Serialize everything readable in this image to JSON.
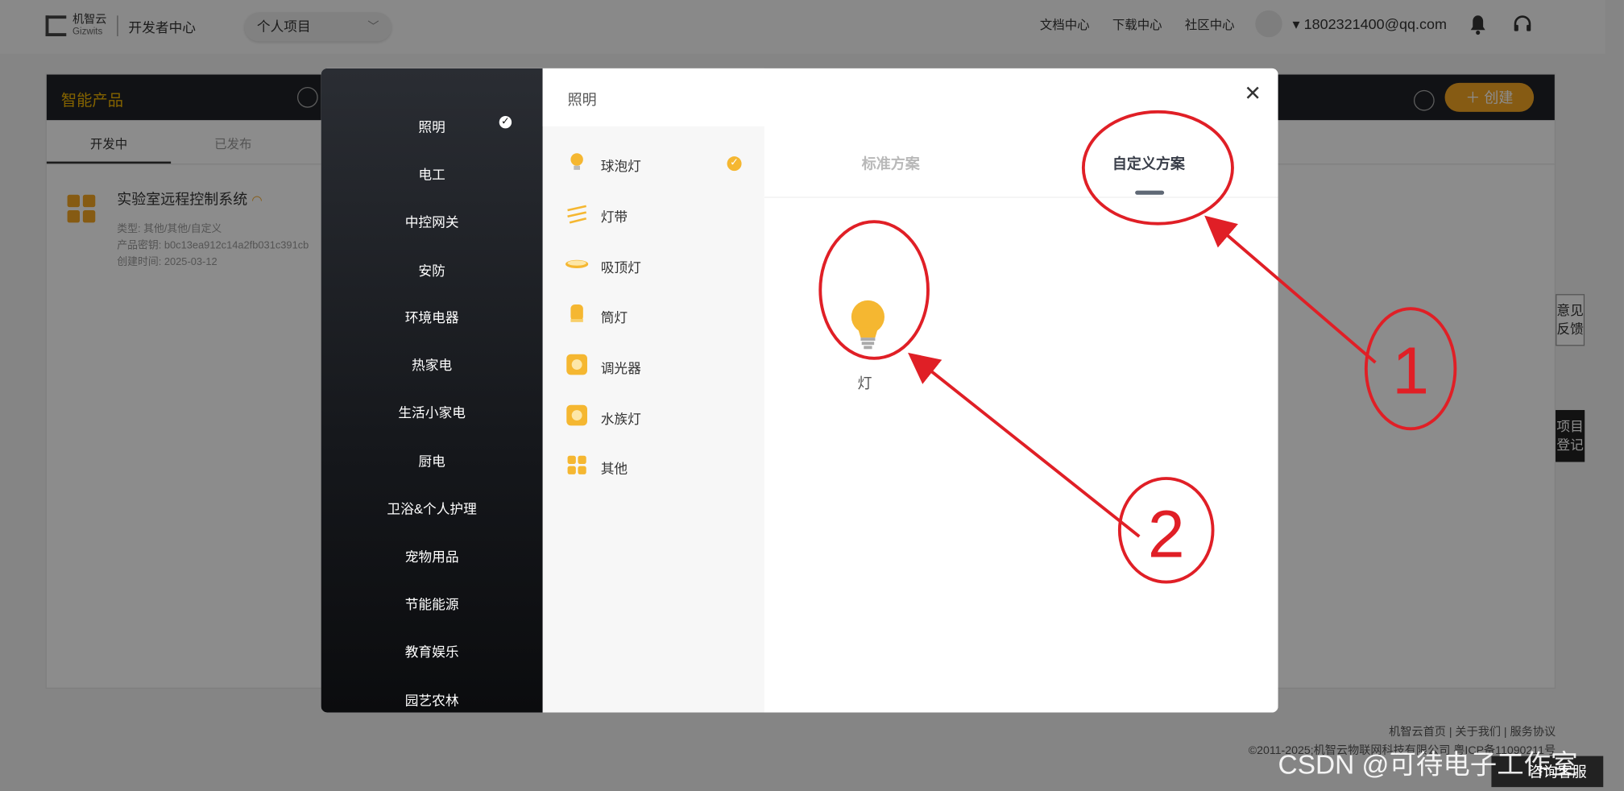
{
  "topbar": {
    "logo_cn": "机智云",
    "logo_en": "Gizwits",
    "dev_center": "开发者中心",
    "project_select": "个人项目",
    "nav_links": [
      "文档中心",
      "下载中心",
      "社区中心"
    ],
    "user_email": "▾ 1802321400@qq.com"
  },
  "page": {
    "section_title": "智能产品",
    "create_label": "＋ 创建",
    "tabs": [
      "开发中",
      "已发布"
    ],
    "product": {
      "name": "实验室远程控制系统",
      "type": "类型: 其他/其他/自定义",
      "key": "产品密钥: b0c13ea912c14a2fb031c391cb",
      "created": "创建时间: 2025-03-12"
    }
  },
  "footer": {
    "links": "机智云首页 | 关于我们 | 服务协议",
    "copyright": "©2011-2025;机智云物联网科技有限公司 粤ICP备11090211号"
  },
  "side_tags": [
    "意见反馈",
    "项目登记"
  ],
  "consult_label": "咨询客服",
  "watermark": "CSDN @可待电子工作室",
  "modal": {
    "title": "照明",
    "categories": [
      "照明",
      "电工",
      "中控网关",
      "安防",
      "环境电器",
      "热家电",
      "生活小家电",
      "厨电",
      "卫浴&个人护理",
      "宠物用品",
      "节能能源",
      "教育娱乐",
      "园艺农林"
    ],
    "selected_category": "照明",
    "sub_categories": [
      {
        "label": "球泡灯",
        "icon": "bulb-icon"
      },
      {
        "label": "灯带",
        "icon": "strip-light-icon"
      },
      {
        "label": "吸顶灯",
        "icon": "ceiling-light-icon"
      },
      {
        "label": "筒灯",
        "icon": "downlight-icon"
      },
      {
        "label": "调光器",
        "icon": "dimmer-icon"
      },
      {
        "label": "水族灯",
        "icon": "aquarium-light-icon"
      },
      {
        "label": "其他",
        "icon": "other-grid-icon"
      }
    ],
    "selected_sub": "球泡灯",
    "scheme_tabs": [
      "标准方案",
      "自定义方案"
    ],
    "active_scheme": "自定义方案",
    "devices": [
      {
        "label": "灯",
        "icon": "bulb-icon"
      }
    ]
  },
  "annotations": {
    "mark1": "1",
    "mark2": "2",
    "color": "#e01f26"
  },
  "colors": {
    "accent": "#f5a623",
    "dark": "#1f2227"
  }
}
